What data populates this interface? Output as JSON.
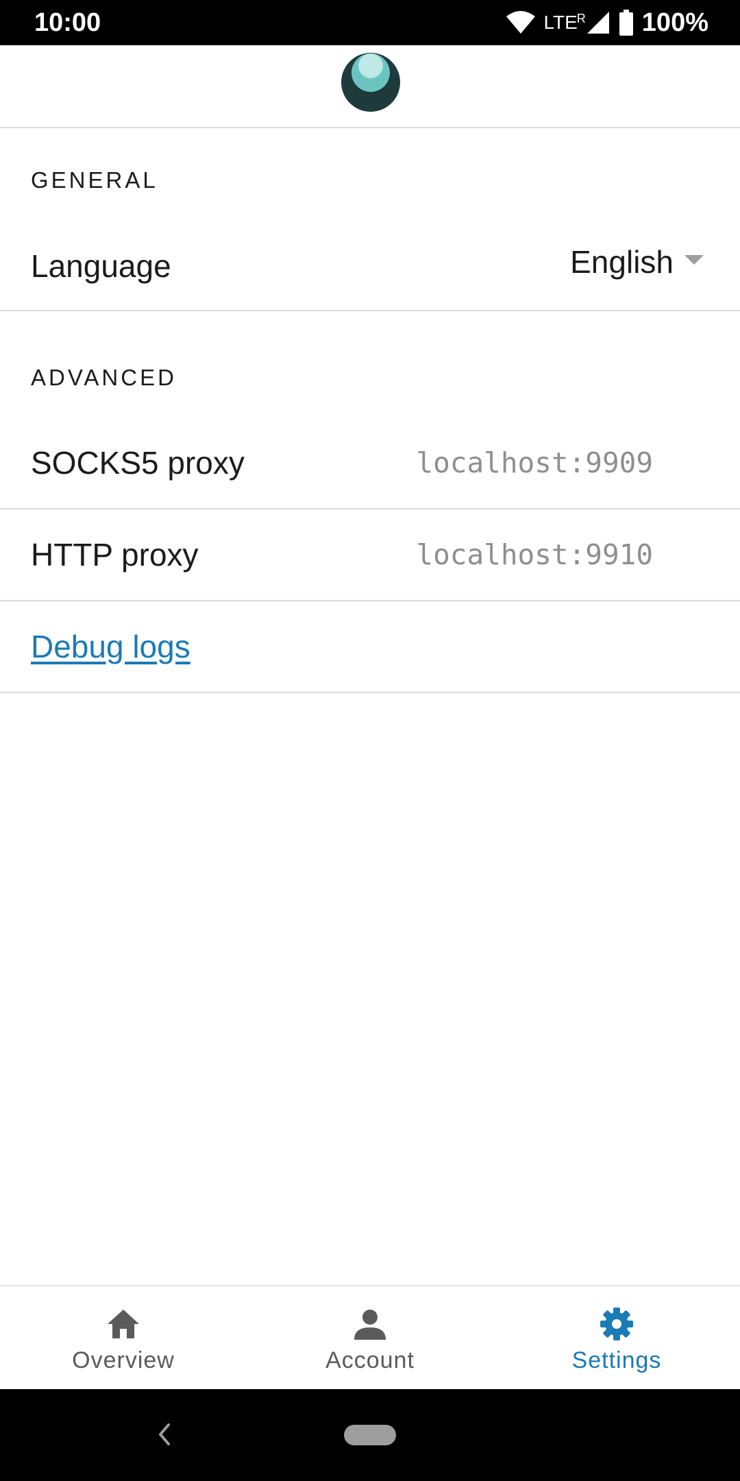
{
  "status_bar": {
    "time": "10:00",
    "network": "LTE",
    "roaming": "R",
    "battery": "100%"
  },
  "settings": {
    "general": {
      "heading": "GENERAL",
      "language_label": "Language",
      "language_value": "English"
    },
    "advanced": {
      "heading": "ADVANCED",
      "socks_label": "SOCKS5 proxy",
      "socks_value": "localhost:9909",
      "http_label": "HTTP proxy",
      "http_value": "localhost:9910",
      "debug_logs_label": "Debug logs"
    }
  },
  "bottom_nav": {
    "items": [
      {
        "label": "Overview",
        "icon": "home-icon",
        "active": false
      },
      {
        "label": "Account",
        "icon": "person-icon",
        "active": false
      },
      {
        "label": "Settings",
        "icon": "gear-icon",
        "active": true
      }
    ]
  },
  "colors": {
    "accent": "#1a7bb5",
    "text": "#1b1b1b",
    "muted": "#8e8e8e",
    "divider": "#dcdcdc",
    "logo_dark": "#1f3a3a",
    "logo_light": "#7fd0cc"
  }
}
